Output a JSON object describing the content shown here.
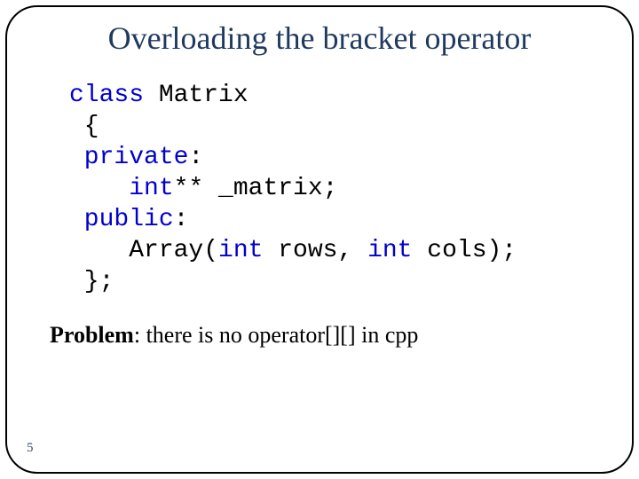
{
  "title": "Overloading the bracket operator",
  "code": {
    "l1_kw": "class ",
    "l1_rest": "Matrix",
    "l2": " {",
    "l3_kw": " private",
    "l3_rest": ":",
    "l4_kw": "    int",
    "l4_rest": "** _matrix;",
    "l5_kw": " public",
    "l5_rest": ":",
    "l6a": "    Array(",
    "l6b_kw": "int ",
    "l6c": "rows, ",
    "l6d_kw": "int ",
    "l6e": "cols);",
    "l7": " };"
  },
  "note": {
    "bold": "Problem",
    "rest": ": there is no operator[][] in cpp"
  },
  "page": "5"
}
